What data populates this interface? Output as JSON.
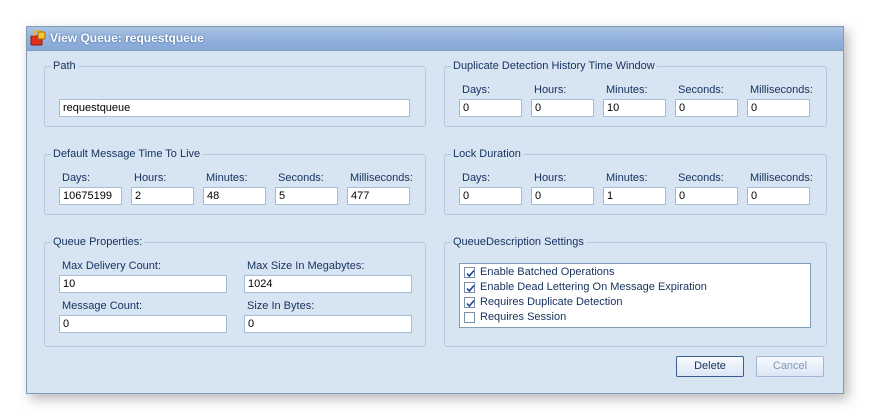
{
  "window": {
    "title": "View Queue: requestqueue"
  },
  "path": {
    "legend": "Path",
    "value": "requestqueue"
  },
  "ttl": {
    "legend": "Default Message Time To Live",
    "fields": [
      {
        "label": "Days:",
        "value": "10675199"
      },
      {
        "label": "Hours:",
        "value": "2"
      },
      {
        "label": "Minutes:",
        "value": "48"
      },
      {
        "label": "Seconds:",
        "value": "5"
      },
      {
        "label": "Milliseconds:",
        "value": "477"
      }
    ]
  },
  "dup": {
    "legend": "Duplicate Detection History Time Window",
    "fields": [
      {
        "label": "Days:",
        "value": "0"
      },
      {
        "label": "Hours:",
        "value": "0"
      },
      {
        "label": "Minutes:",
        "value": "10"
      },
      {
        "label": "Seconds:",
        "value": "0"
      },
      {
        "label": "Milliseconds:",
        "value": "0"
      }
    ]
  },
  "lock": {
    "legend": "Lock Duration",
    "fields": [
      {
        "label": "Days:",
        "value": "0"
      },
      {
        "label": "Hours:",
        "value": "0"
      },
      {
        "label": "Minutes:",
        "value": "1"
      },
      {
        "label": "Seconds:",
        "value": "0"
      },
      {
        "label": "Milliseconds:",
        "value": "0"
      }
    ]
  },
  "props": {
    "legend": "Queue Properties:",
    "max_delivery_label": "Max Delivery Count:",
    "max_delivery_value": "10",
    "max_size_label": "Max Size In Megabytes:",
    "max_size_value": "1024",
    "message_count_label": "Message Count:",
    "message_count_value": "0",
    "size_bytes_label": "Size In Bytes:",
    "size_bytes_value": "0"
  },
  "settings": {
    "legend": "QueueDescription Settings",
    "items": [
      {
        "label": "Enable Batched Operations",
        "checked": true
      },
      {
        "label": "Enable Dead Lettering On Message Expiration",
        "checked": true
      },
      {
        "label": "Requires Duplicate Detection",
        "checked": true
      },
      {
        "label": "Requires Session",
        "checked": false
      }
    ]
  },
  "buttons": {
    "delete": "Delete",
    "cancel": "Cancel"
  }
}
